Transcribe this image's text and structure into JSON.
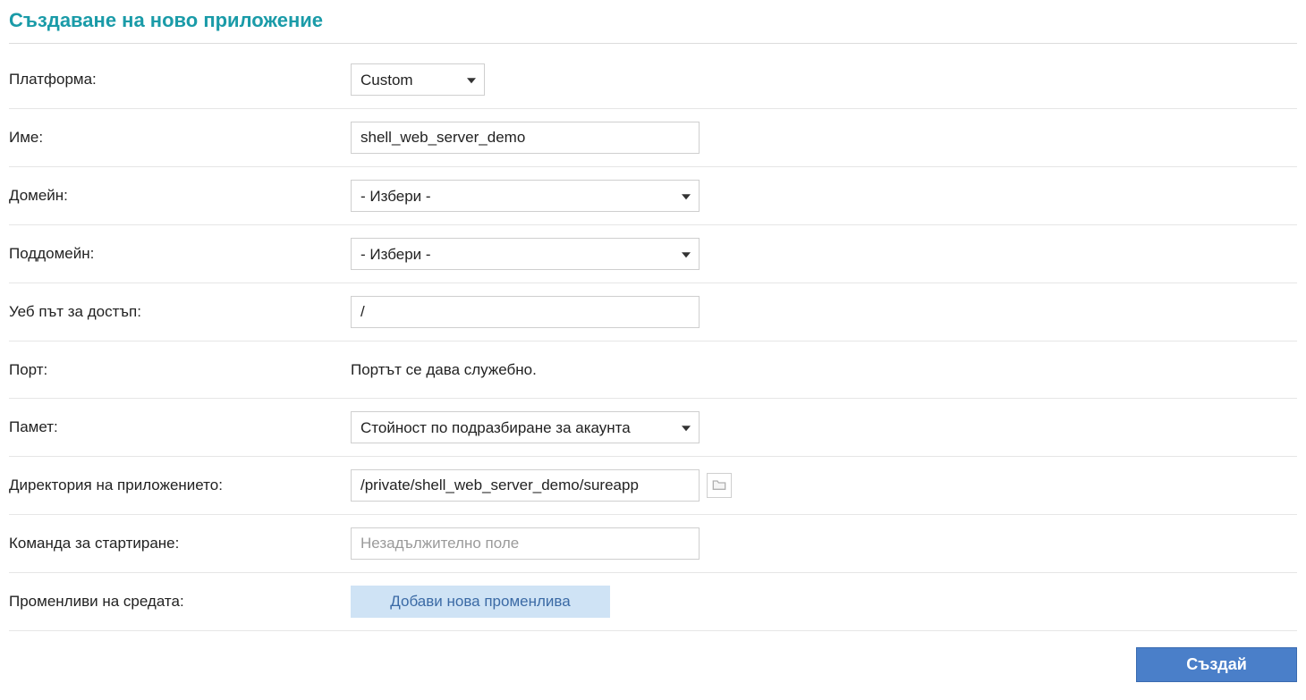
{
  "title": "Създаване на ново приложение",
  "labels": {
    "platform": "Платформа:",
    "name": "Име:",
    "domain": "Домейн:",
    "subdomain": "Поддомейн:",
    "webPath": "Уеб път за достъп:",
    "port": "Порт:",
    "memory": "Памет:",
    "appDir": "Директория на приложението:",
    "startCmd": "Команда за стартиране:",
    "envVars": "Променливи на средата:"
  },
  "values": {
    "platform": "Custom",
    "name": "shell_web_server_demo",
    "domain": "- Избери -",
    "subdomain": "- Избери -",
    "webPath": "/",
    "portInfo": "Портът се дава служебно.",
    "memory": "Стойност по подразбиране за акаунта",
    "appDir": "/private/shell_web_server_demo/sureapp",
    "startCmdPlaceholder": "Незадължително поле"
  },
  "buttons": {
    "addVar": "Добави нова променлива",
    "submit": "Създай"
  }
}
